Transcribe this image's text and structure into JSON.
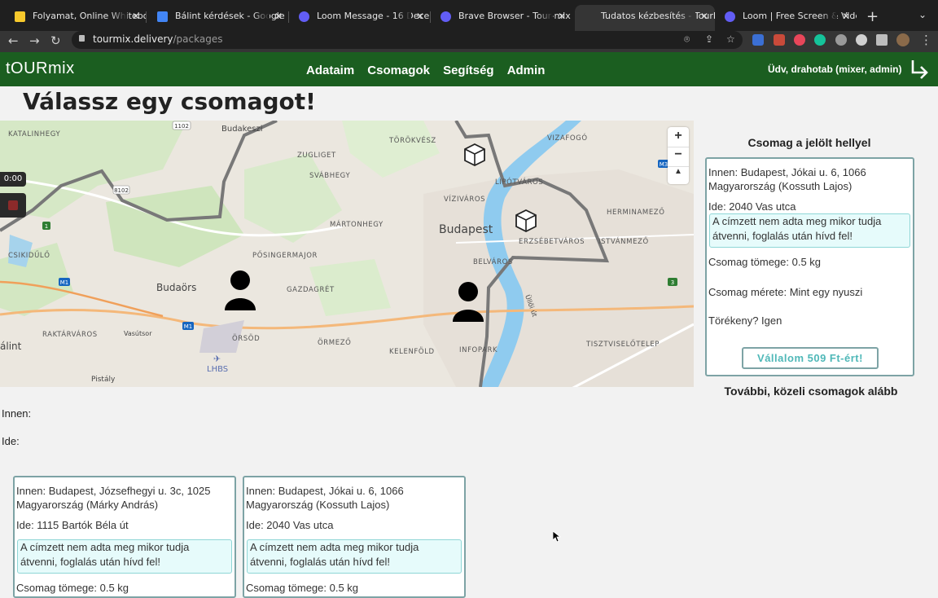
{
  "browser": {
    "tabs": [
      {
        "label": "Folyamat, Online Whiteboa",
        "favicon": "miro-icon",
        "color": "#f7c92c"
      },
      {
        "label": "Bálint kérdések - Google Do",
        "favicon": "google-docs-icon",
        "color": "#4285f4"
      },
      {
        "label": "Loom Message - 16 Decem",
        "favicon": "loom-icon",
        "color": "#625df5"
      },
      {
        "label": "Brave Browser - Tour-mix |",
        "favicon": "loom-icon",
        "color": "#625df5"
      },
      {
        "label": "Tudatos kézbesítés - TourM",
        "favicon": "blank-icon",
        "color": "#353535"
      },
      {
        "label": "Loom | Free Screen & Video",
        "favicon": "loom-icon",
        "color": "#625df5"
      }
    ],
    "url_host": "tourmix.delivery",
    "url_path": "/packages"
  },
  "header": {
    "logo": "tOURmix",
    "nav": [
      "Adataim",
      "Csomagok",
      "Segítség",
      "Admin"
    ],
    "greeting": "Üdv, drahotab (mixer, admin)"
  },
  "page": {
    "title": "Válassz egy csomagot!",
    "from_label": "Innen:",
    "to_label": "Ide:"
  },
  "map": {
    "labels": {
      "budapest": "Budapest",
      "budaors": "Budaörs",
      "budakeszi": "Budakeszi",
      "katalinhegy": "KATALINHEGY",
      "csillebérc": "CSIKIDŰLŐ",
      "svabhegy": "SVÁBHEGY",
      "zuglget": "ZUGLIGET",
      "martonhegy": "MÁRTONHEGY",
      "posingermajor": "PŐSINGERMAJOR",
      "gazdagret": "GAZDAGRÉT",
      "raktarvaros": "RAKTÁRVÁROS",
      "orsod": "ÖRSÖD",
      "ormezo": "ÖRMEZŐ",
      "kelenfold": "KELENFÖLD",
      "infopark": "INFOPARK",
      "lhbs": "LHBS",
      "pistaly": "Pistály",
      "vasutsor": "Vasútsor",
      "torokvesz": "TÖRÖKVÉSZ",
      "vizafogo": "VIZAFOGÓ",
      "lipotvaros": "LIPÓTVÁROS",
      "vizivaros": "VÍZIVÁROS",
      "erzsebetvaros": "ERZSÉBETVÁROS",
      "istvanmezo": "ISTVÁNMEZŐ",
      "hermanmezo": "HERMINAMEZŐ",
      "belvaros": "BELVÁROS",
      "tisztviselotelep": "TISZTVISELŐTELEP",
      "ulloi": "Üllői út",
      "alint": "álint",
      "road_1102": "1102",
      "road_8102": "8102",
      "road_m1": "M1",
      "road_m3": "M3",
      "road_3": "3",
      "road_1": "1"
    },
    "zoom_in": "+",
    "zoom_out": "−",
    "compass": "▲"
  },
  "selected_package": {
    "heading": "Csomag a jelölt hellyel",
    "from": "Innen: Budapest, Jókai u. 6, 1066 Magyarország (Kossuth Lajos)",
    "to": "Ide: 2040 Vas utca",
    "note": "A címzett nem adta meg mikor tudja átvenni, foglalás után hívd fel!",
    "weight": "Csomag tömege: 0.5 kg",
    "size": "Csomag mérete: Mint egy nyuszi",
    "fragile": "Törékeny? Igen",
    "button": "Vállalom 509 Ft-ért!"
  },
  "more_heading": "További, közeli csomagok alább",
  "packages": [
    {
      "from": "Innen: Budapest, Józsefhegyi u. 3c, 1025 Magyarország (Márky András)",
      "to": "Ide: 1115 Bartók Béla út",
      "note": "A címzett nem adta meg mikor tudja átvenni, foglalás után hívd fel!",
      "weight": "Csomag tömege: 0.5 kg"
    },
    {
      "from": "Innen: Budapest, Jókai u. 6, 1066 Magyarország (Kossuth Lajos)",
      "to": "Ide: 2040 Vas utca",
      "note": "A címzett nem adta meg mikor tudja átvenni, foglalás után hívd fel!",
      "weight": "Csomag tömege: 0.5 kg"
    }
  ],
  "recorder": {
    "time": "0:00"
  },
  "colors": {
    "header_green": "#1b5e20",
    "accent_teal": "#4fb8b8",
    "card_border": "#7da3a5"
  }
}
